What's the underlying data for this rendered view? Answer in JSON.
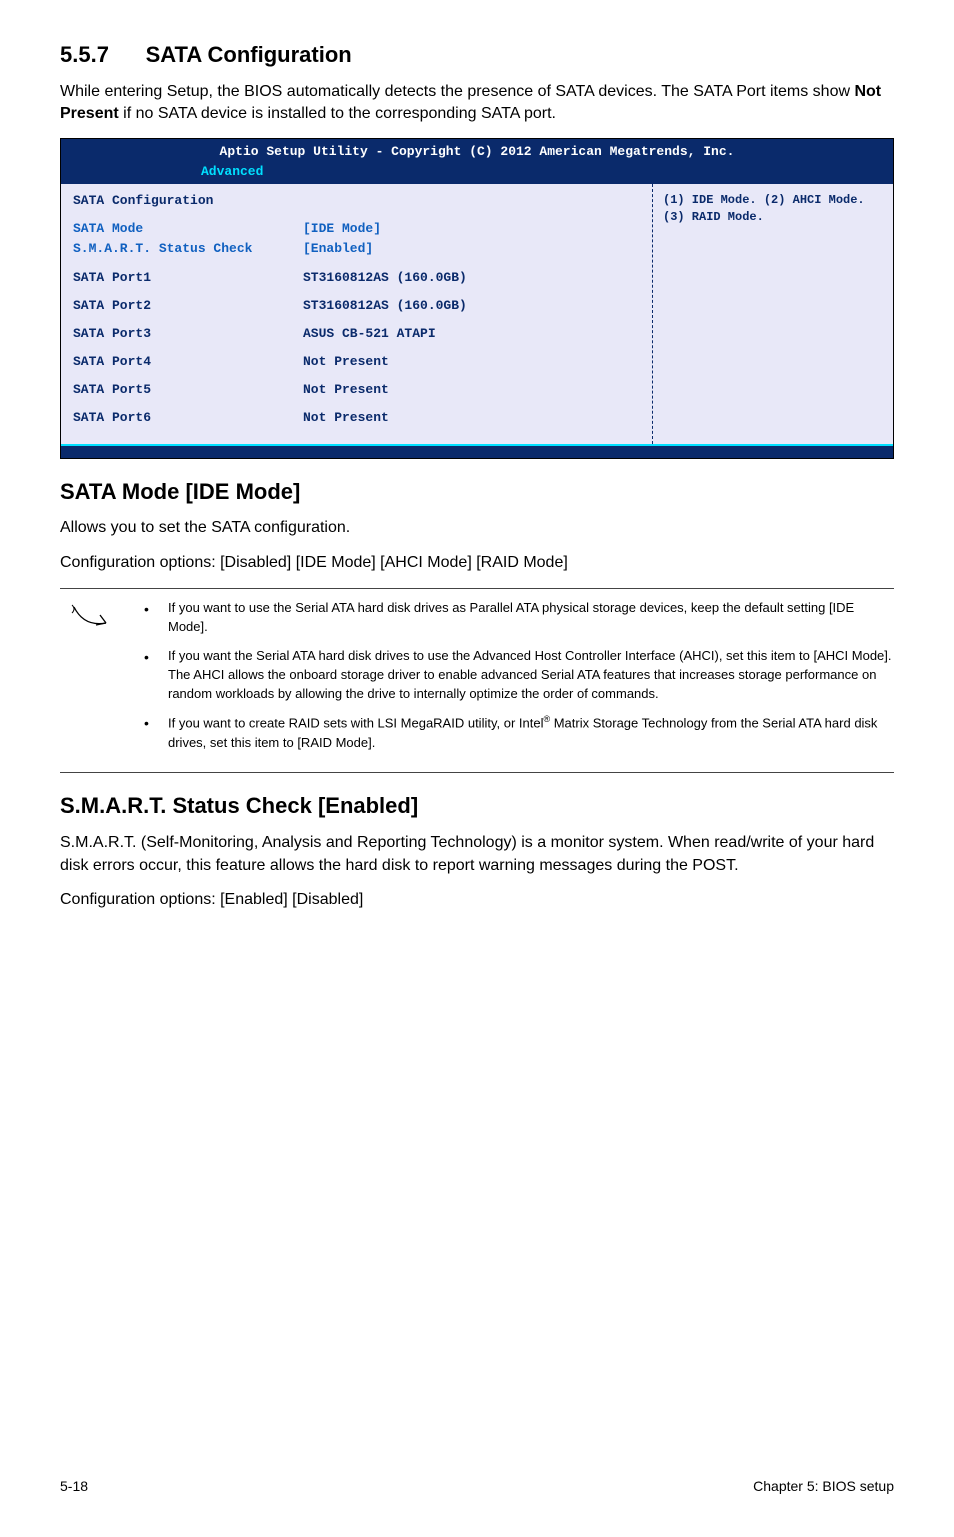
{
  "section": {
    "num": "5.5.7",
    "title": "SATA Configuration"
  },
  "intro": "While entering Setup, the BIOS automatically detects the presence of SATA devices. The SATA Port items show Not Present if no SATA device is installed to the corresponding SATA port.",
  "intro_parts": {
    "a": "While entering Setup, the BIOS automatically detects the presence of SATA devices. The SATA Port items show ",
    "b": "Not Present",
    "c": " if no SATA device is installed to the corresponding SATA port."
  },
  "bios": {
    "title": "Aptio Setup Utility - Copyright (C) 2012 American Megatrends, Inc.",
    "tab": "Advanced",
    "header": "SATA Configuration",
    "sata_mode": {
      "label": "SATA Mode",
      "value": "[IDE Mode]"
    },
    "smart": {
      "label": "S.M.A.R.T. Status Check",
      "value": "[Enabled]"
    },
    "ports": [
      {
        "label": "SATA Port1",
        "value": "ST3160812AS (160.0GB)"
      },
      {
        "label": "SATA Port2",
        "value": "ST3160812AS (160.0GB)"
      },
      {
        "label": "SATA Port3",
        "value": "ASUS CB-521 ATAPI"
      },
      {
        "label": "SATA Port4",
        "value": "Not Present"
      },
      {
        "label": "SATA Port5",
        "value": "Not Present"
      },
      {
        "label": "SATA Port6",
        "value": "Not Present"
      }
    ],
    "help": "(1) IDE Mode. (2) AHCI Mode. (3) RAID Mode."
  },
  "sata_mode_heading": "SATA Mode [IDE Mode]",
  "sata_mode_desc": "Allows you to set the SATA configuration.",
  "sata_mode_opts": "Configuration options: [Disabled] [IDE Mode] [AHCI Mode] [RAID Mode]",
  "notes": [
    "If you want to use the Serial ATA hard disk drives as Parallel ATA physical storage devices, keep the default setting [IDE Mode].",
    "If you want the Serial ATA hard disk drives to use the Advanced Host Controller Interface (AHCI), set this item to [AHCI Mode]. The AHCI allows the onboard storage driver to enable advanced Serial ATA features that increases storage performance on random workloads by allowing the drive to internally optimize the order of commands.",
    "If you want to create RAID sets with LSI MegaRAID utility, or Intel® Matrix Storage Technology from the Serial ATA hard disk drives, set this item to [RAID Mode]."
  ],
  "note3": {
    "a": "If you want to create RAID sets with LSI MegaRAID utility, or Intel",
    "sup": "®",
    "b": " Matrix Storage Technology from the Serial ATA hard disk drives, set this item to [RAID Mode]."
  },
  "smart_heading": "S.M.A.R.T. Status Check [Enabled]",
  "smart_desc": "S.M.A.R.T. (Self-Monitoring, Analysis and Reporting Technology) is a monitor system. When read/write of your hard disk errors occur, this feature allows the hard disk to report warning messages during the POST.",
  "smart_opts": "Configuration options: [Enabled] [Disabled]",
  "footer": {
    "left": "5-18",
    "right": "Chapter 5: BIOS setup"
  }
}
